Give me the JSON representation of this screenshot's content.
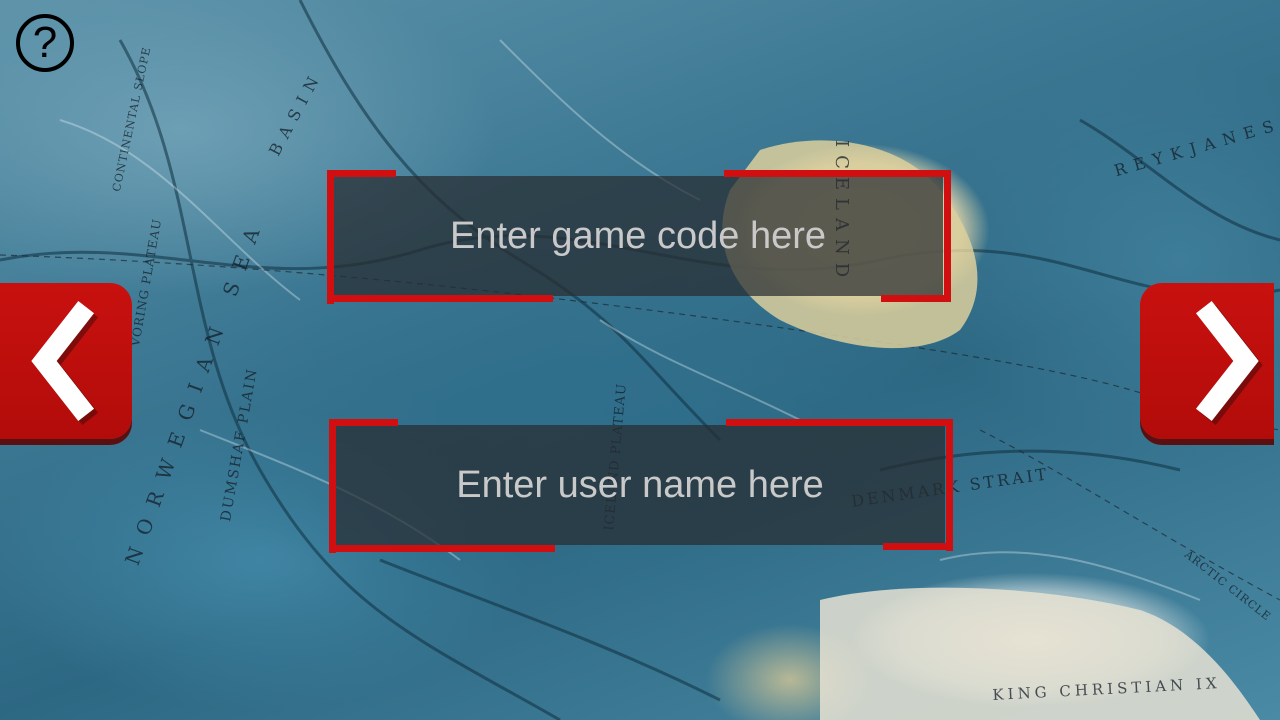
{
  "help": {
    "symbol": "?",
    "icon": "question-mark-icon"
  },
  "nav": {
    "prev_icon": "chevron-left-icon",
    "next_icon": "chevron-right-icon",
    "button_color": "#c8110f"
  },
  "form": {
    "game_code": {
      "placeholder": "Enter game code here",
      "value": ""
    },
    "user_name": {
      "placeholder": "Enter user name here",
      "value": ""
    },
    "frame_color": "#d20f10"
  },
  "map_labels": {
    "basin": "BASIN",
    "iceland": "ICELAND",
    "reykjanes": "REYKJANES",
    "denmark_strait": "DENMARK STRAIT",
    "norwegian_sea": "NORWEGIAN SEA",
    "dumshaf_plain": "DUMSHAF PLAIN",
    "king_christian": "KING CHRISTIAN IX",
    "voring_plateau": "VORING PLATEAU",
    "iceland_plateau": "ICELAND PLATEAU",
    "continental_slope": "CONTINENTAL SLOPE",
    "arctic_circle": "ARCTIC CIRCLE"
  }
}
